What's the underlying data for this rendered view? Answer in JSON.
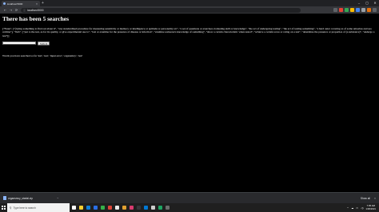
{
  "browser": {
    "tab_title": "localhost:5000",
    "new_tab_symbol": "+",
    "tab_close_symbol": "×",
    "url": "localhost:5000",
    "lock_icon": "ⓘ",
    "nav": {
      "back": "←",
      "forward": "→",
      "reload": "⟳"
    },
    "window_controls": [
      "–",
      "▢",
      "✕"
    ],
    "extension_colors": [
      "#5f6368",
      "#e94235",
      "#34a853",
      "#fbbc04",
      "#4285f4",
      "#9aa0a6",
      "#e8710a",
      "#5f6368"
    ]
  },
  "page": {
    "heading": "There has been 5 searches",
    "definitions": "[\"Noun\", [\"(trying something to find out about it\", \"any standardized procedure for measuring sensitivity or memory or intelligence or aptitude or personality etc\", \"a set of questions or exercises evaluating skill or knowledge\", \"the act of undergoing testing\", \"the act of testing something\", \"a hard outer covering as of some amoebas and sea urchins\"], \"Verb\", [\"put to the test, as for its quality, or give experimental use to\", \"test or examine for the presence of disease or infection\", \"examine someone's knowledge of something\", \"show a certain characteristic when tested\", \"achieve a certain score or rating on a test\", \"determine the presence or properties of (a substance)\", \"undergo a test\"]]",
    "search_input_value": "",
    "submit_label": "Submit",
    "searched_words": "Words you have searched so far 'test', 'test', 'input error', 'organsmcy', 'test'"
  },
  "downloads": {
    "file_name": "organsmcy_startal.zip",
    "caret": "^",
    "show_all": "Show all",
    "close": "×"
  },
  "taskbar": {
    "search_placeholder": "Type here to search",
    "search_icon": "⚲",
    "app_colors": [
      "#ffffff",
      "#f9d030",
      "#0f7fd9",
      "#2a6ee6",
      "#35b14a",
      "#dc4437",
      "#e9e9e9",
      "#e0a030",
      "#d83b6f",
      "#35363a",
      "#0078d4",
      "#cccccc",
      "#1da462",
      "#6c6c6c"
    ],
    "tray_symbols": [
      "^",
      "☁",
      "▭",
      "◁)"
    ],
    "time": "7:05 AM",
    "date": "1/30/2021"
  }
}
